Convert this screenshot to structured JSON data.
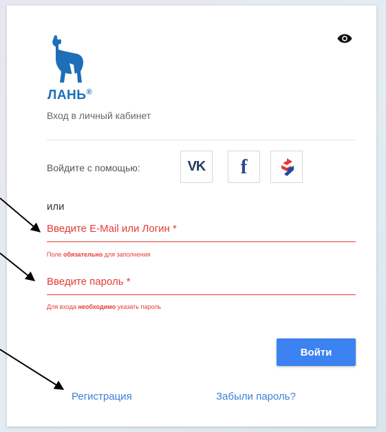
{
  "login": {
    "subtitle": "Вход в личный кабинет",
    "social_label": "Войдите с помощью:",
    "social": [
      {
        "name": "vk-icon",
        "text": "VK"
      },
      {
        "name": "facebook-icon",
        "text": "f"
      },
      {
        "name": "gosuslugi-icon"
      }
    ],
    "or_text": "или",
    "email": {
      "label": "Введите E-Mail или Логин *",
      "hint_a": "Поле ",
      "hint_b": "обязательно",
      "hint_c": " для заполнения"
    },
    "password": {
      "label": "Введите пароль *",
      "hint_a": "Для входа ",
      "hint_b": "необходимо",
      "hint_c": " указать пароль"
    },
    "submit_label": "Войти",
    "register_label": "Регистрация",
    "forgot_label": "Забыли пароль?"
  },
  "logo": {
    "text": "ЛАНЬ",
    "mark": "®",
    "color": "#1d6fb8"
  },
  "colors": {
    "accent": "#3c82f0",
    "error": "#e53935",
    "link": "#3c7fd8"
  }
}
